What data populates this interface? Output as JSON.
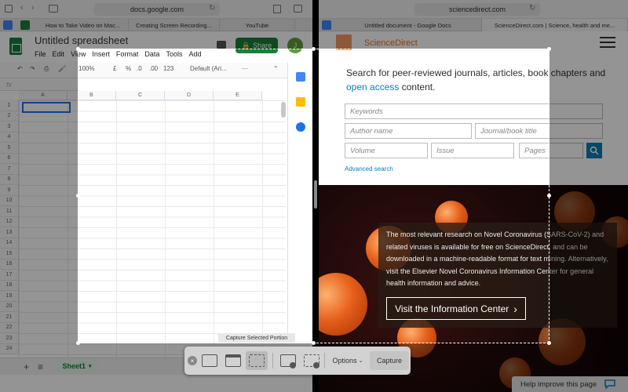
{
  "left_browser": {
    "address": "docs.google.com",
    "tabs": [
      "How to Take Video on Mac...",
      "Creating Screen Recording...",
      "YouTube"
    ]
  },
  "sheets": {
    "title": "Untitled spreadsheet",
    "menu": [
      "File",
      "Edit",
      "View",
      "Insert",
      "Format",
      "Data",
      "Tools",
      "Add"
    ],
    "share_label": "Share",
    "avatar_initial": "J",
    "toolbar": {
      "zoom": "100%",
      "currency": "£",
      "percent": "%",
      "decimal_less": ".0",
      "decimal_more": ".00",
      "number_format": "123",
      "font": "Default (Ari...",
      "more": "⋯"
    },
    "formula_prefix": "fx",
    "columns": [
      "A",
      "B",
      "C",
      "D",
      "E"
    ],
    "rows": [
      "1",
      "2",
      "3",
      "4",
      "5",
      "6",
      "7",
      "8",
      "9",
      "10",
      "11",
      "12",
      "13",
      "14",
      "15",
      "16",
      "17",
      "18",
      "19",
      "20",
      "21",
      "22",
      "23",
      "24"
    ],
    "sheet_tab": "Sheet1",
    "add_sheet": "+",
    "all_sheets": "≡"
  },
  "right_browser": {
    "address": "sciencedirect.com",
    "tabs": [
      "Untitled document - Google Docs",
      "ScienceDirect.com | Science, health and me..."
    ]
  },
  "sciencedirect": {
    "brand": "ScienceDirect",
    "intro_before_link": "Search for peer-reviewed journals, articles, book chapters and ",
    "intro_link": "open access",
    "intro_after_link": " content.",
    "placeholders": {
      "keywords": "Keywords",
      "author": "Author name",
      "journal": "Journal/book title",
      "volume": "Volume",
      "issue": "Issue",
      "pages": "Pages"
    },
    "advanced_search": "Advanced search",
    "hero_text": "The most relevant research on Novel Coronavirus (SARS-CoV-2) and related viruses is available for free on ScienceDirect, and can be downloaded in a machine-readable format for text mining. Alternatively, visit the Elsevier Novel Coronavirus Information Center for general health information and advice.",
    "hero_button": "Visit the Information Center",
    "help": "Help improve this page"
  },
  "screenshot_tool": {
    "selection_label": "Capture Selected Portion",
    "options_label": "Options",
    "capture_label": "Capture"
  },
  "colors": {
    "sheets_green": "#188038",
    "sd_orange": "#e9711c",
    "sd_link_blue": "#0c7dbb"
  }
}
